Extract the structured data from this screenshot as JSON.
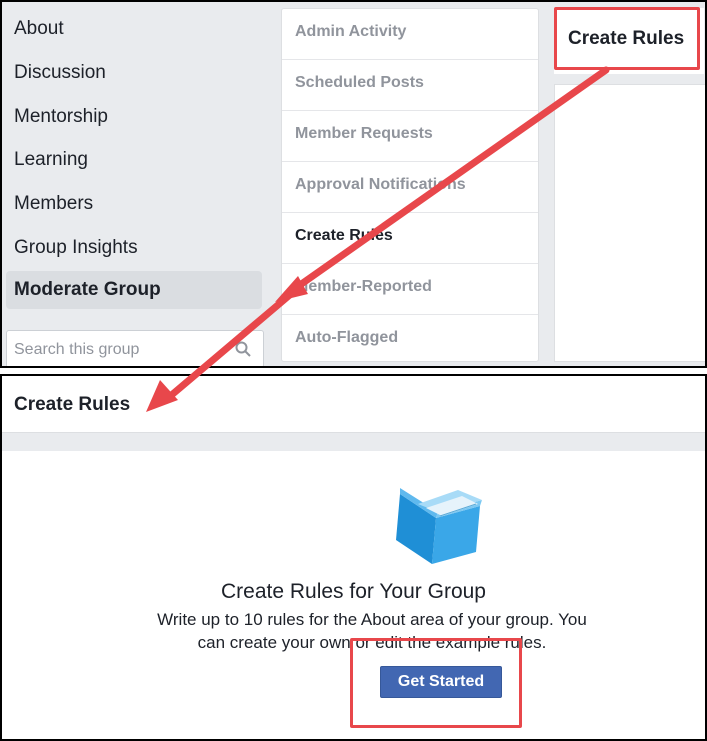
{
  "top": {
    "left_nav": {
      "items": [
        {
          "label": "About"
        },
        {
          "label": "Discussion"
        },
        {
          "label": "Mentorship"
        },
        {
          "label": "Learning"
        },
        {
          "label": "Members"
        },
        {
          "label": "Group Insights"
        },
        {
          "label": "Moderate Group",
          "selected": true
        }
      ],
      "search_placeholder": "Search this group"
    },
    "moderate_menu": {
      "items": [
        {
          "label": "Admin Activity"
        },
        {
          "label": "Scheduled Posts"
        },
        {
          "label": "Member Requests"
        },
        {
          "label": "Approval Notifications"
        },
        {
          "label": "Create Rules",
          "active": true
        },
        {
          "label": "Member-Reported"
        },
        {
          "label": "Auto-Flagged"
        }
      ]
    },
    "right_header": "Create Rules"
  },
  "bottom": {
    "header": "Create Rules",
    "cta": {
      "title": "Create Rules for Your Group",
      "description": "Write up to 10 rules for the About area of your group. You can create your own or edit the example rules.",
      "button": "Get Started"
    }
  },
  "colors": {
    "annotation_red": "#e8474b",
    "button_blue": "#4267b2",
    "sidebar_bg": "#e9ebee",
    "book_blue": "#3aa7e8"
  }
}
